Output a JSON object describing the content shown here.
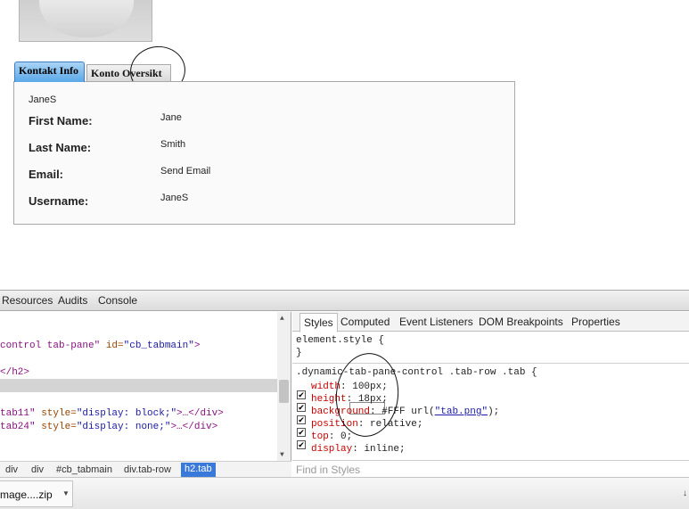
{
  "page": {
    "tabs": [
      {
        "label": "Kontakt Info",
        "active": true
      },
      {
        "label": "Konto Oversikt",
        "active": false
      }
    ],
    "contact": {
      "username_top": "JaneS",
      "rows": [
        {
          "label": "First Name:",
          "value": "Jane"
        },
        {
          "label": "Last Name:",
          "value": "Smith"
        },
        {
          "label": "Email:",
          "value": "Send Email"
        },
        {
          "label": "Username:",
          "value": "JaneS"
        }
      ]
    }
  },
  "devtools": {
    "toolbar": [
      "Resources",
      "Audits",
      "Console"
    ],
    "elements": {
      "line1": "control tab-pane\" id=\"cb_tabmain\">",
      "line1_tag": "control tab-pane\"",
      "line1_attr": " id=",
      "line1_str": "\"cb_tabmain\"",
      "line1_end": ">",
      "line2": "</h2>",
      "line3_tag": "tab11\"",
      "line3_attr": " style=",
      "line3_str": "\"display: block;\"",
      "line3_end": ">…</div>",
      "line4_tag": "tab24\"",
      "line4_attr": " style=",
      "line4_str": "\"display: none;\"",
      "line4_end": ">…</div>"
    },
    "breadcrumbs": [
      "div",
      "div",
      "#cb_tabmain",
      "div.tab-row",
      "h2.tab"
    ],
    "styles_tabs": [
      "Styles",
      "Computed",
      "Event Listeners",
      "DOM Breakpoints",
      "Properties"
    ],
    "styles": {
      "element_style_open": "element.style {",
      "element_style_close": "}",
      "selector": ".dynamic-tab-pane-control .tab-row .tab {",
      "props": [
        {
          "name": "width",
          "value": "100px;"
        },
        {
          "name": "height",
          "value": "18px;"
        },
        {
          "name": "background",
          "value": "#FFF url(",
          "url": "\"tab.png\"",
          "tail": ");"
        },
        {
          "name": "position",
          "value": "relative;"
        },
        {
          "name": "top",
          "value": "0;"
        },
        {
          "name": "display",
          "value": "inline;"
        }
      ],
      "find_placeholder": "Find in Styles"
    }
  },
  "download": {
    "file_name": "mage....zip",
    "more_arrow": "↓"
  },
  "icons": {
    "dropdown": "dropdown-arrow-icon",
    "check": "✔"
  }
}
